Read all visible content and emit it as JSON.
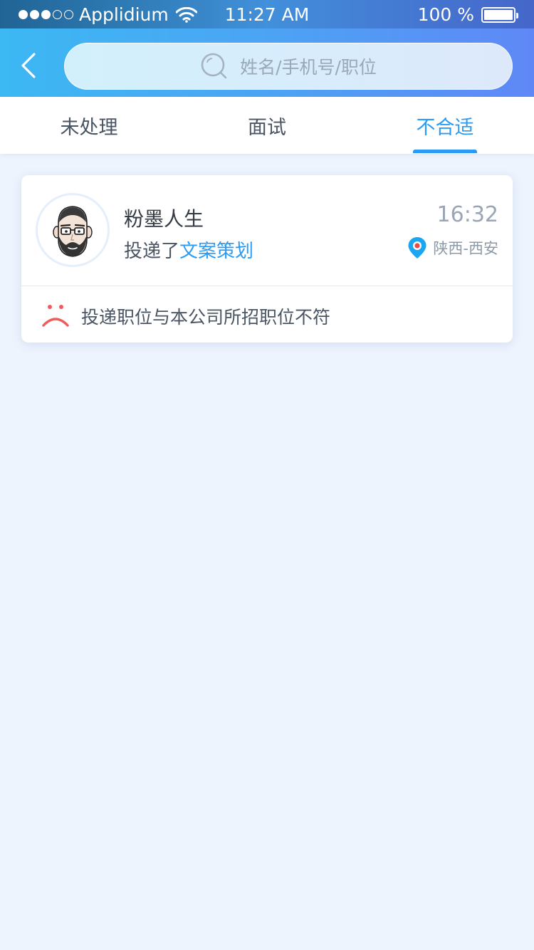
{
  "status_bar": {
    "carrier": "Applidium",
    "time": "11:27 AM",
    "battery": "100 %",
    "signal_bars_filled": 3,
    "signal_bars_total": 5
  },
  "header": {
    "search_placeholder": "姓名/手机号/职位"
  },
  "tabs": [
    {
      "label": "未处理",
      "active": false
    },
    {
      "label": "面试",
      "active": false
    },
    {
      "label": "不合适",
      "active": true
    }
  ],
  "card": {
    "name": "粉墨人生",
    "applied_prefix": "投递了",
    "job_title": "文案策划",
    "time": "16:32",
    "location": "陕西-西安",
    "reason": "投递职位与本公司所招职位不符"
  },
  "icons": {
    "back": "chevron-left-icon",
    "search": "search-icon",
    "location": "location-pin-icon",
    "reason": "sad-face-icon"
  },
  "colors": {
    "accent": "#2b9af3",
    "sad": "#f05b5b",
    "pin": "#1aa6f0"
  }
}
